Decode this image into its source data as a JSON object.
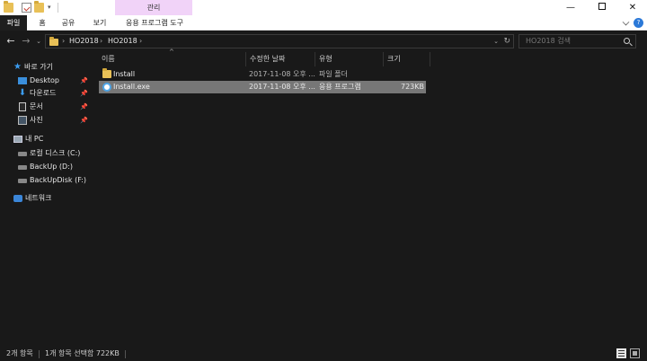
{
  "titlebar": {
    "context_tab": "관리",
    "quick_access_dropdown": "▾",
    "buttons": {
      "minimize": "—",
      "maximize": "",
      "close": "✕"
    }
  },
  "ribbon": {
    "tabs": [
      {
        "label": "파일"
      },
      {
        "label": "홈"
      },
      {
        "label": "공유"
      },
      {
        "label": "보기"
      },
      {
        "label": "응용 프로그램 도구"
      }
    ],
    "help": "?"
  },
  "address": {
    "breadcrumb": [
      "HO2018",
      "HO2018"
    ],
    "separator": "›",
    "back": "←",
    "forward": "→",
    "recent": "⌄",
    "up": "↑",
    "refresh": "↻",
    "dropdown": "⌄"
  },
  "search": {
    "placeholder": "HO2018 검색"
  },
  "sidebar": {
    "quick_access": "바로 가기",
    "pinned": [
      {
        "label": "Desktop",
        "icon": "desktop-icon"
      },
      {
        "label": "다운로드",
        "icon": "download-icon"
      },
      {
        "label": "문서",
        "icon": "document-icon"
      },
      {
        "label": "사진",
        "icon": "pictures-icon"
      }
    ],
    "this_pc": "내 PC",
    "drives": [
      {
        "label": "로컬 디스크 (C:)"
      },
      {
        "label": "BackUp (D:)"
      },
      {
        "label": "BackUpDisk (F:)"
      }
    ],
    "network": "네트워크",
    "pin_glyph": "📌"
  },
  "columns": {
    "name": "이름",
    "date": "수정한 날짜",
    "type": "유형",
    "size": "크기"
  },
  "files": [
    {
      "name": "Install",
      "date": "2017-11-08 오후 ...",
      "type": "파일 폴더",
      "size": "",
      "kind": "folder",
      "selected": false
    },
    {
      "name": "Install.exe",
      "date": "2017-11-08 오후 ...",
      "type": "응용 프로그램",
      "size": "723KB",
      "kind": "exe",
      "selected": true
    }
  ],
  "status": {
    "item_count": "2개 항목",
    "selection": "1개 항목 선택함 722KB"
  },
  "colors": {
    "background": "#191919",
    "selection": "#777777",
    "context_tab": "#f1d3f8",
    "accent": "#3b9cf0",
    "folder": "#e8c057"
  }
}
